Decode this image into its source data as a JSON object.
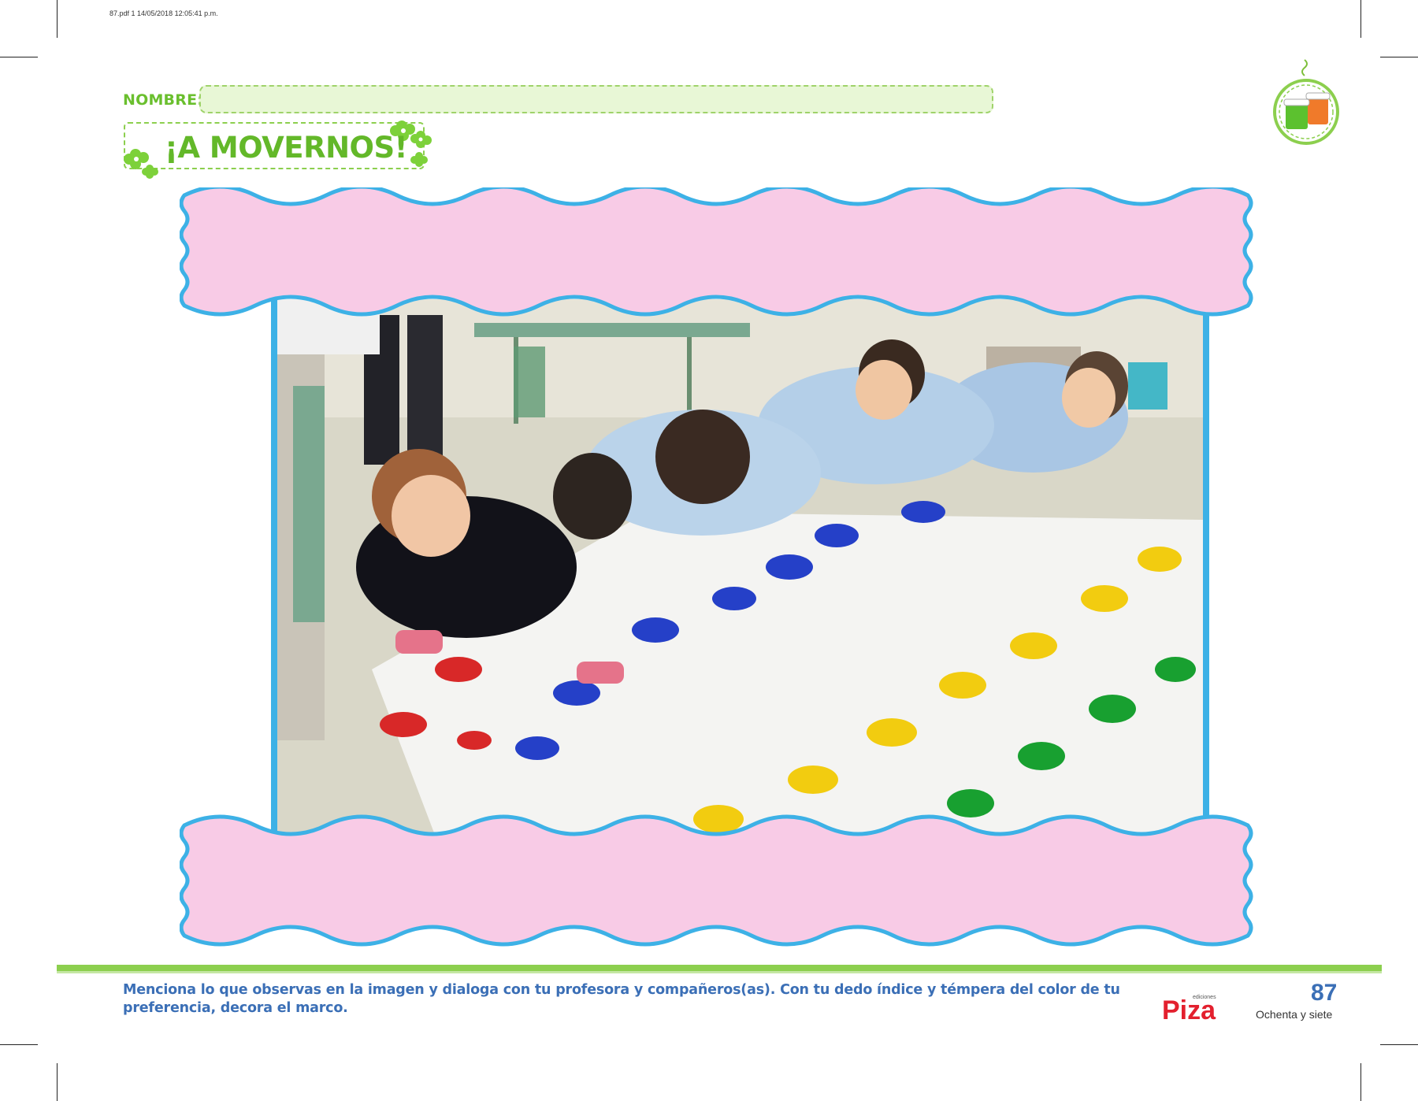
{
  "print_header": "87.pdf   1   14/05/2018   12:05:41 p.m.",
  "worksheet": {
    "name_label": "NOMBRE:",
    "name_value": "",
    "title": "¡A MOVERNOS!"
  },
  "photo": {
    "subject": "children crawling on a sheet with painted handprints"
  },
  "footer": {
    "instruction": "Menciona lo que observas en la imagen y dialoga con tu profesora y compañeros(as). Con tu dedo índice y témpera del color de tu preferencia, decora el marco.",
    "publisher_small": "ediciones",
    "publisher": "Piza",
    "page_number": "87",
    "page_words": "Ochenta y siete"
  },
  "colors": {
    "green": "#6abf2e",
    "frame_pink": "#f8cbe6",
    "frame_blue": "#3db1e6",
    "text_blue": "#3b6fb6",
    "brand_red": "#e3202e"
  }
}
